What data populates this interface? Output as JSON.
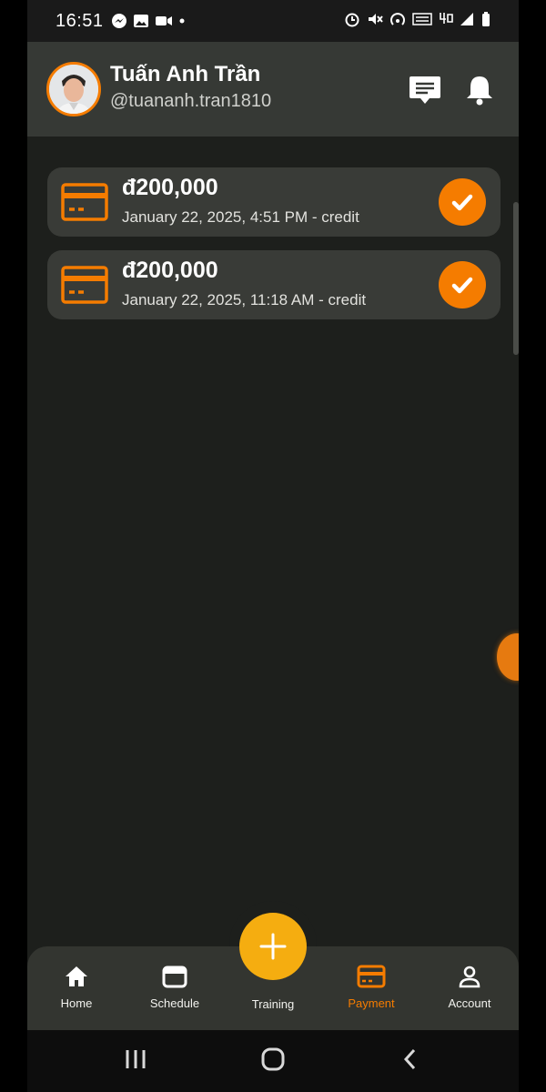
{
  "status_bar": {
    "time": "16:51",
    "icons": [
      "messenger-icon",
      "gallery-icon",
      "video-icon",
      "dot-icon",
      "alarm-icon",
      "mute-icon",
      "hotspot-icon",
      "volte-icon",
      "4g-icon",
      "signal-icon",
      "battery-icon"
    ]
  },
  "header": {
    "name": "Tuấn Anh Trần",
    "handle": "@tuananh.tran1810",
    "icons": [
      "message-icon",
      "bell-icon"
    ]
  },
  "transactions": [
    {
      "amount": "đ200,000",
      "meta": "January 22, 2025, 4:51 PM - credit",
      "status": "completed"
    },
    {
      "amount": "đ200,000",
      "meta": "January 22, 2025, 11:18 AM - credit",
      "status": "completed"
    }
  ],
  "bottom_nav": {
    "items": [
      {
        "label": "Home",
        "icon": "home-icon"
      },
      {
        "label": "Schedule",
        "icon": "calendar-icon"
      },
      {
        "label": "Training",
        "icon": "plus-icon"
      },
      {
        "label": "Payment",
        "icon": "card-icon"
      },
      {
        "label": "Account",
        "icon": "account-icon"
      }
    ],
    "active": "Payment"
  },
  "colors": {
    "accent": "#f57c00",
    "fab": "#f5ad10",
    "background": "#1d1f1c",
    "card": "#393b37"
  }
}
